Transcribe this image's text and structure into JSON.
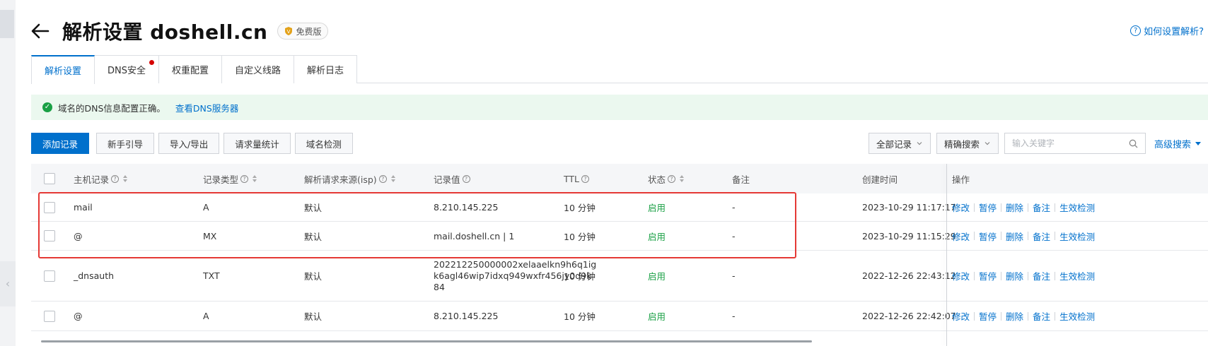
{
  "header": {
    "title": "解析设置 doshell.cn",
    "plan_badge": "免费版",
    "help_link": "如何设置解析?"
  },
  "tabs": [
    {
      "label": "解析设置",
      "active": true
    },
    {
      "label": "DNS安全",
      "has_dot": true
    },
    {
      "label": "权重配置"
    },
    {
      "label": "自定义线路"
    },
    {
      "label": "解析日志"
    }
  ],
  "notice": {
    "text": "域名的DNS信息配置正确。",
    "link": "查看DNS服务器"
  },
  "toolbar": {
    "add": "添加记录",
    "guide": "新手引导",
    "import_export": "导入/导出",
    "stats": "请求量统计",
    "check": "域名检测",
    "filter": "全部记录",
    "search_mode": "精确搜索",
    "search_placeholder": "输入关键字",
    "advanced": "高级搜索"
  },
  "table": {
    "headers": {
      "host": "主机记录",
      "type": "记录类型",
      "isp": "解析请求来源(isp)",
      "value": "记录值",
      "ttl": "TTL",
      "status": "状态",
      "remark": "备注",
      "created": "创建时间",
      "ops": "操作"
    },
    "ops_labels": {
      "edit": "修改",
      "pause": "暂停",
      "delete": "删除",
      "remark": "备注",
      "check": "生效检测"
    },
    "rows": [
      {
        "host": "mail",
        "type": "A",
        "isp": "默认",
        "value": "8.210.145.225",
        "ttl": "10 分钟",
        "status": "启用",
        "remark": "-",
        "created": "2023-10-29 11:17:17"
      },
      {
        "host": "@",
        "type": "MX",
        "isp": "默认",
        "value": "mail.doshell.cn | 1",
        "ttl": "10 分钟",
        "status": "启用",
        "remark": "-",
        "created": "2023-10-29 11:15:29"
      },
      {
        "host": "_dnsauth",
        "type": "TXT",
        "isp": "默认",
        "value_lines": [
          "202212250000002xelaaelkn9h6q1ig",
          "k6agl46wip7idxq949wxfr456jy0d9k",
          "84"
        ],
        "ttl": "10 分钟",
        "status": "启用",
        "remark": "-",
        "created": "2022-12-26 22:43:12"
      },
      {
        "host": "@",
        "type": "A",
        "isp": "默认",
        "value": "8.210.145.225",
        "ttl": "10 分钟",
        "status": "启用",
        "remark": "-",
        "created": "2022-12-26 22:42:07"
      }
    ]
  },
  "colors": {
    "accent": "#0070cc",
    "success": "#1aa045",
    "highlight_border": "#e53935",
    "notice_bg": "#ebf8ef"
  }
}
